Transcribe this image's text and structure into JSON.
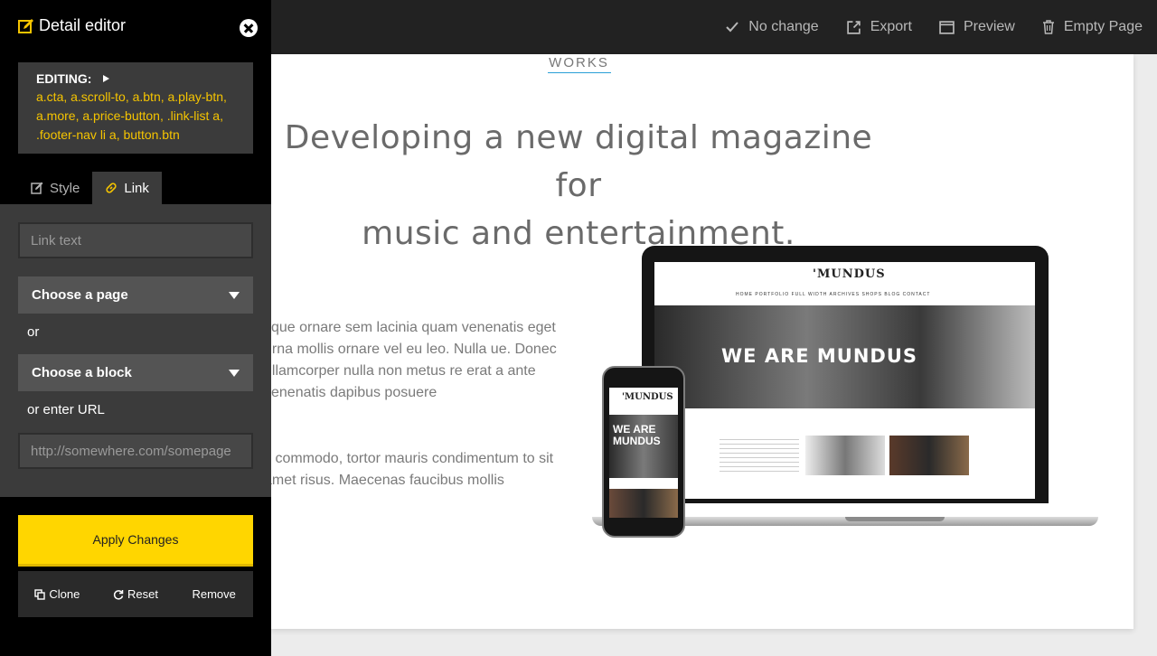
{
  "topbar": {
    "actions": [
      {
        "icon": "check-icon",
        "label": "No change"
      },
      {
        "icon": "export-icon",
        "label": "Export"
      },
      {
        "icon": "preview-icon",
        "label": "Preview"
      },
      {
        "icon": "trash-icon",
        "label": "Empty Page"
      }
    ]
  },
  "page": {
    "section_title": "MOST RECENT WORKS",
    "headline_line1": "Developing a new digital magazine for",
    "headline_line2": "music and entertainment.",
    "paragraph1": "sque ornare sem lacinia quam venenatis eget urna mollis ornare vel eu leo. Nulla ue. Donec ullamcorper nulla non metus re erat a ante venenatis dapibus posuere",
    "paragraph2": "s commodo, tortor mauris condimentum to sit amet risus. Maecenas faucibus mollis",
    "mockup": {
      "laptop_logo": "'MUNDUS",
      "laptop_nav": "HOME   PORTFOLIO   FULL WIDTH   ARCHIVES   SHOPS   BLOG   CONTACT",
      "laptop_hero": "WE ARE MUNDUS",
      "phone_logo": "'MUNDUS",
      "phone_hero": "WE ARE MUNDUS"
    }
  },
  "editor": {
    "title": "Detail editor",
    "editing_label": "EDITING:",
    "editing_selectors": "a.cta, a.scroll-to, a.btn, a.play-btn, a.more, a.price-button, .link-list a, .footer-nav li a, button.btn",
    "tabs": [
      {
        "icon": "edit-icon",
        "label": "Style"
      },
      {
        "icon": "link-icon",
        "label": "Link"
      }
    ],
    "link_text_placeholder": "Link text",
    "choose_page": "Choose a page",
    "or_label": "or",
    "choose_block": "Choose a block",
    "or_url_label": "or enter URL",
    "url_placeholder": "http://somewhere.com/somepage",
    "apply_label": "Apply Changes",
    "clone_label": "Clone",
    "reset_label": "Reset",
    "remove_label": "Remove"
  },
  "colors": {
    "accent_yellow": "#ffd600",
    "selector_yellow": "#f5c400",
    "topbar_bg": "#222222",
    "panel_bg": "#3b3b3b",
    "underline_blue": "#2a9fd6"
  }
}
